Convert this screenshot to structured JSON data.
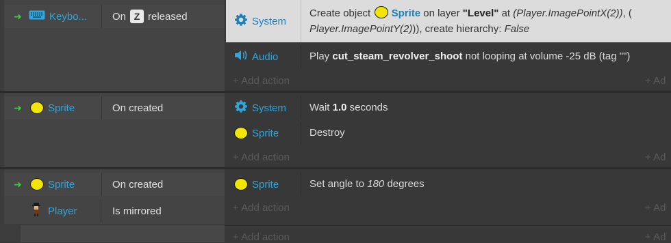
{
  "events": [
    {
      "conditions": [
        {
          "object": "Keybo...",
          "icon": "keyboard-icon",
          "text_before": "On",
          "key": "Z",
          "text_after": "released"
        }
      ],
      "actions": [
        {
          "object": "System",
          "icon": "gear-icon",
          "parts": {
            "p1": "Create object",
            "obj": "Sprite",
            "p2": "on layer",
            "layer": "\"Level\"",
            "p3": "at",
            "expr1": "(Player.ImagePointX(2))",
            "p4": ", (",
            "expr2": "Player.ImagePointY(2)",
            "p5": ")), create hierarchy:",
            "hier": "False"
          }
        },
        {
          "object": "Audio",
          "icon": "speaker-icon",
          "parts": {
            "p1": "Play",
            "sound": "cut_steam_revolver_shoot",
            "p2": "not looping at volume -25 dB (tag \"\")"
          }
        }
      ],
      "add_action": "+ Add action",
      "add_right": "+ Ad"
    },
    {
      "conditions": [
        {
          "object": "Sprite",
          "icon": "sprite-icon",
          "text": "On created"
        }
      ],
      "actions": [
        {
          "object": "System",
          "icon": "gear-icon",
          "parts": {
            "p1": "Wait",
            "val": "1.0",
            "p2": "seconds"
          }
        },
        {
          "object": "Sprite",
          "icon": "sprite-icon",
          "parts": {
            "p1": "Destroy"
          }
        }
      ],
      "add_action": "+ Add action",
      "add_right": "+ Ad"
    },
    {
      "conditions": [
        {
          "object": "Sprite",
          "icon": "sprite-icon",
          "text": "On created"
        },
        {
          "object": "Player",
          "icon": "player-icon",
          "text": "Is mirrored"
        }
      ],
      "actions": [
        {
          "object": "Sprite",
          "icon": "sprite-icon",
          "parts": {
            "p1": "Set angle to",
            "val": "180",
            "p2": "degrees"
          }
        }
      ],
      "add_action": "+ Add action",
      "add_right": "+ Ad"
    }
  ],
  "bottom_add_action": "+ Add action",
  "bottom_add_right": "+ Ad",
  "colors": {
    "object_link": "#2fa6dc",
    "trigger_arrow": "#3ec93e",
    "sprite_fill": "#f2e600"
  }
}
